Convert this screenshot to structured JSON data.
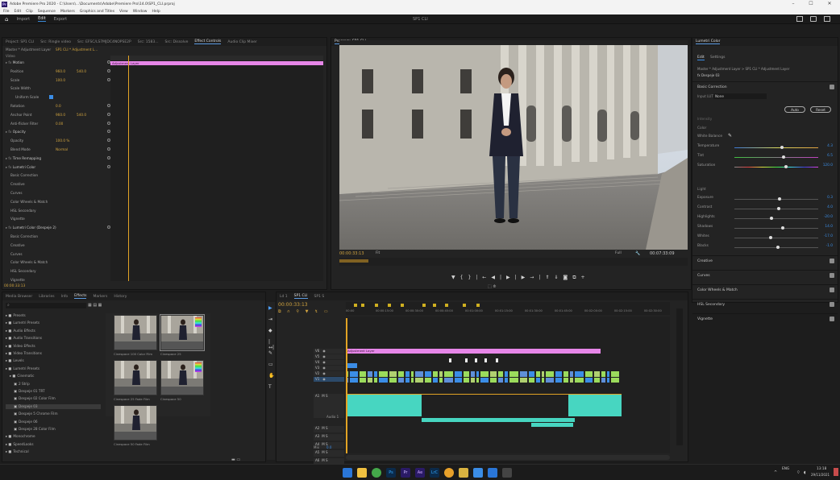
{
  "window": {
    "title": "Adobe Premiere Pro 2020 - C:\\Users\\...\\Documents\\Adobe\\Premiere Pro\\14.0\\SP1_CLI.prproj",
    "minimize": "–",
    "maximize": "☐",
    "close": "✕"
  },
  "menu": [
    "File",
    "Edit",
    "Clip",
    "Sequence",
    "Markers",
    "Graphics and Titles",
    "View",
    "Window",
    "Help"
  ],
  "workspace": {
    "home": "⌂",
    "tabs": [
      "Import",
      "Edit",
      "Export"
    ],
    "active": "Edit",
    "center_title": "SP1 CLI"
  },
  "effect_controls": {
    "tabs": [
      "Project: SP1 CLI",
      "Src: Ringle video",
      "Src: EFSC/LS7MJDC4NOPSE2P",
      "Src: 1583...",
      "Src: Dissolve",
      "Effect Controls",
      "Audio Clip Mixer"
    ],
    "active_tab": "Effect Controls",
    "clip_header": "Master * Adjustment Layer",
    "clip_link": "SP1 CLI * Adjustment L...",
    "timeline_clip": "Adjustment Layer",
    "video_label": "Video",
    "rows": [
      {
        "label": "Motion",
        "indent": 0,
        "kind": "group"
      },
      {
        "label": "Position",
        "indent": 1,
        "value": "960.0",
        "value2": "540.0"
      },
      {
        "label": "Scale",
        "indent": 1,
        "value": "100.0"
      },
      {
        "label": "Scale Width",
        "indent": 1,
        "value": ""
      },
      {
        "label": "Uniform Scale",
        "indent": 2,
        "value": "",
        "checkbox": true
      },
      {
        "label": "Rotation",
        "indent": 1,
        "value": "0.0"
      },
      {
        "label": "Anchor Point",
        "indent": 1,
        "value": "960.0",
        "value2": "540.0"
      },
      {
        "label": "Anti-flicker Filter",
        "indent": 1,
        "value": "0.00"
      },
      {
        "label": "Opacity",
        "indent": 0,
        "kind": "group"
      },
      {
        "label": "Opacity",
        "indent": 1,
        "value": "100.0 %"
      },
      {
        "label": "Blend Mode",
        "indent": 1,
        "value": "Normal"
      },
      {
        "label": "Time Remapping",
        "indent": 0,
        "kind": "group"
      },
      {
        "label": "Lumetri Color",
        "indent": 0,
        "kind": "group"
      },
      {
        "label": "Basic Correction",
        "indent": 1,
        "value": ""
      },
      {
        "label": "Creative",
        "indent": 1,
        "value": ""
      },
      {
        "label": "Curves",
        "indent": 1,
        "value": ""
      },
      {
        "label": "Color Wheels & Match",
        "indent": 1,
        "value": ""
      },
      {
        "label": "HSL Secondary",
        "indent": 1,
        "value": ""
      },
      {
        "label": "Vignette",
        "indent": 1,
        "value": ""
      },
      {
        "label": "Lumetri Color (Despeje 2)",
        "indent": 0,
        "kind": "group"
      },
      {
        "label": "Basic Correction",
        "indent": 1,
        "value": ""
      },
      {
        "label": "Creative",
        "indent": 1,
        "value": ""
      },
      {
        "label": "Curves",
        "indent": 1,
        "value": ""
      },
      {
        "label": "Color Wheels & Match",
        "indent": 1,
        "value": ""
      },
      {
        "label": "HSL Secondary",
        "indent": 1,
        "value": ""
      },
      {
        "label": "Vignette",
        "indent": 1,
        "value": ""
      }
    ],
    "timecode": "00:00:33:13"
  },
  "program": {
    "title": "Program: SP1 CLI",
    "timecode_left": "00:00:33:13",
    "fit": "Fit",
    "quality": "Full",
    "timecode_right": "00:07:33:09",
    "ruler_ticks": [
      "00:00",
      "00:00:14:23",
      "00:00:29:23",
      "00:00:44:22",
      "00:00:59:22",
      "00:01:14:22",
      "00:01:29:21",
      "00:01:44:21",
      "00:01:59:21"
    ]
  },
  "lumetri": {
    "header": "Lumetri Color",
    "tabs": [
      "Edit",
      "Settings"
    ],
    "clip_line": "Master * Adjustment Layer  >  SP1 CLI * Adjustment Layer",
    "fx_line": "fx   Despeje 03",
    "basic_correction": "Basic Correction",
    "input_lut_label": "Input LUT",
    "input_lut": "None",
    "auto_btn": "Auto",
    "reset_btn": "Reset",
    "intensity_label": "Intensity",
    "color_label": "Color",
    "white_balance": "White Balance",
    "sliders_color": [
      {
        "label": "Temperature",
        "value": "4.3",
        "pos": 0.55
      },
      {
        "label": "Tint",
        "value": "6.5",
        "pos": 0.57
      },
      {
        "label": "Saturation",
        "value": "120.0",
        "pos": 0.6
      }
    ],
    "light_label": "Light",
    "sliders_light": [
      {
        "label": "Exposure",
        "value": "0.3",
        "pos": 0.52
      },
      {
        "label": "Contrast",
        "value": "4.0",
        "pos": 0.51
      },
      {
        "label": "Highlights",
        "value": "-20.0",
        "pos": 0.42
      },
      {
        "label": "Shadows",
        "value": "14.0",
        "pos": 0.56
      },
      {
        "label": "Whites",
        "value": "-17.0",
        "pos": 0.41
      },
      {
        "label": "Blacks",
        "value": "-1.0",
        "pos": 0.5
      }
    ],
    "sections": [
      "Creative",
      "Curves",
      "Color Wheels & Match",
      "HSL Secondary",
      "Vignette"
    ]
  },
  "project": {
    "tabs": [
      "Media Browser",
      "Libraries",
      "Info",
      "Effects",
      "Markers",
      "History"
    ],
    "active_tab": "Effects",
    "search_placeholder": "",
    "tree": [
      {
        "label": "Presets",
        "indent": 0
      },
      {
        "label": "Lumetri Presets",
        "indent": 0
      },
      {
        "label": "Audio Effects",
        "indent": 0
      },
      {
        "label": "Audio Transitions",
        "indent": 0
      },
      {
        "label": "Video Effects",
        "indent": 0
      },
      {
        "label": "Video Transitions",
        "indent": 0
      },
      {
        "label": "Levels",
        "indent": 0
      },
      {
        "label": "Lumetri Presets",
        "indent": 0
      },
      {
        "label": "Cinematic",
        "indent": 1
      },
      {
        "label": "2 Strip",
        "indent": 2
      },
      {
        "label": "Despeje 01 TRT",
        "indent": 2
      },
      {
        "label": "Despeje 02 Color Film",
        "indent": 2
      },
      {
        "label": "Despeje 03",
        "indent": 2,
        "selected": true
      },
      {
        "label": "Despeje 5 Chrome Film",
        "indent": 2
      },
      {
        "label": "Despeje 06",
        "indent": 2
      },
      {
        "label": "Despeje 28 Color Film",
        "indent": 2
      },
      {
        "label": "Monochrome",
        "indent": 0
      },
      {
        "label": "SpeedLooks",
        "indent": 0
      },
      {
        "label": "Technical",
        "indent": 0
      }
    ],
    "thumbs": [
      {
        "label": "Cinespace 100 Color Film"
      },
      {
        "label": "Cinespace 25"
      },
      {
        "label": "Cinespace 25 Fade Film"
      },
      {
        "label": "Cinespace 50"
      },
      {
        "label": "Cinespace 50 Fade Film"
      }
    ]
  },
  "timeline": {
    "tab": "SP1 CLI",
    "other_tabs": [
      "Ld 1",
      "SP1 S"
    ],
    "timecode": "00:00:33:13",
    "ruler": [
      "00:00",
      "00:00:15:00",
      "00:00:30:00",
      "00:00:45:00",
      "00:01:00:00",
      "00:01:15:00",
      "00:01:30:00",
      "00:01:45:00",
      "00:02:00:00",
      "00:02:15:00",
      "00:02:30:00"
    ],
    "tracks_video": [
      "V6",
      "V5",
      "V4",
      "V3",
      "V2",
      "V1"
    ],
    "tracks_audio": [
      "A1",
      "A2",
      "A3",
      "A4",
      "A5",
      "A6"
    ],
    "audio_name": "Audio 1",
    "master_label": "Mix",
    "master_value": "0.0",
    "adjustment_clip": "Adjustment Layer"
  },
  "taskbar": {
    "lang": "ENG",
    "time": "13:18",
    "date": "29/11/2021"
  },
  "colors": {
    "accent_blue": "#3b8de6",
    "playhead": "#e2a325",
    "adjustment_pink": "#e686e8",
    "audio_teal": "#47d6c1",
    "video_green": "#9bdb5c"
  }
}
